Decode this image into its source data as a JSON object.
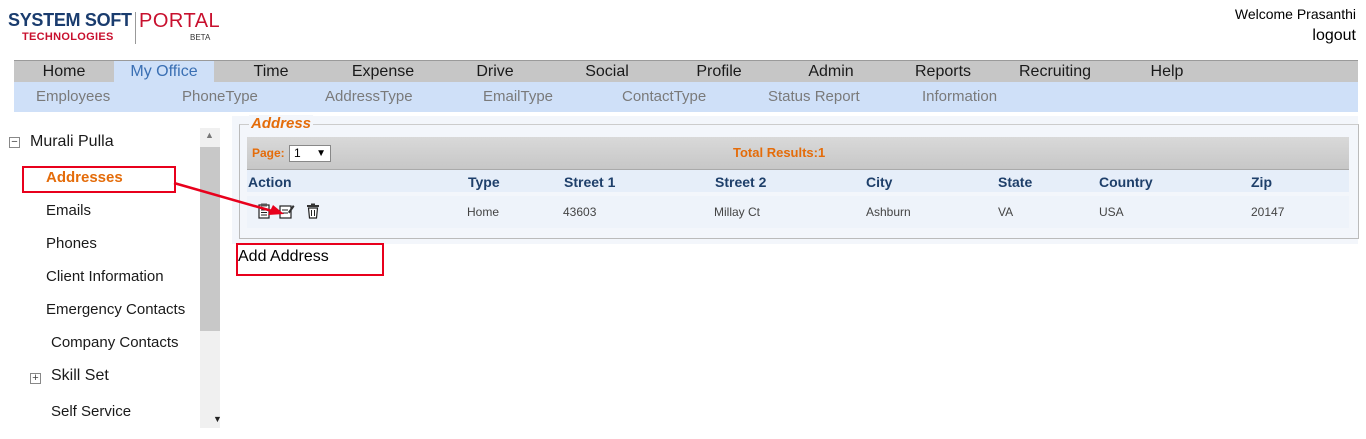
{
  "header": {
    "logo_system_soft": "SYSTEM SOFT",
    "logo_technologies": "TECHNOLOGIES",
    "logo_portal": "PORTAL",
    "logo_beta": "BETA",
    "welcome": "Welcome Prasanthi",
    "logout": "logout"
  },
  "main_nav": [
    {
      "label": "Home"
    },
    {
      "label": "My Office",
      "active": true
    },
    {
      "label": "Time"
    },
    {
      "label": "Expense"
    },
    {
      "label": "Drive"
    },
    {
      "label": "Social"
    },
    {
      "label": "Profile"
    },
    {
      "label": "Admin"
    },
    {
      "label": "Reports"
    },
    {
      "label": "Recruiting"
    },
    {
      "label": "Help"
    }
  ],
  "sub_nav": [
    {
      "label": "Employees"
    },
    {
      "label": "PhoneType"
    },
    {
      "label": "AddressType"
    },
    {
      "label": "EmailType"
    },
    {
      "label": "ContactType"
    },
    {
      "label": "Status Report"
    },
    {
      "label": "Information"
    }
  ],
  "sidebar": {
    "root_label": "Murali Pulla",
    "items": [
      {
        "label": "Addresses",
        "selected": true
      },
      {
        "label": "Emails"
      },
      {
        "label": "Phones"
      },
      {
        "label": "Client Information"
      },
      {
        "label": "Emergency Contacts"
      },
      {
        "label": "Company Contacts"
      },
      {
        "label": "Skill Set"
      },
      {
        "label": "Self Service"
      }
    ]
  },
  "address_panel": {
    "legend": "Address",
    "page_label": "Page:",
    "page_value": "1",
    "total_results": "Total Results:1",
    "columns": [
      "Action",
      "Type",
      "Street 1",
      "Street 2",
      "City",
      "State",
      "Country",
      "Zip"
    ],
    "rows": [
      {
        "type": "Home",
        "street1": "43603",
        "street2": "Millay Ct",
        "city": "Ashburn",
        "state": "VA",
        "country": "USA",
        "zip": "20147"
      }
    ],
    "add_address": "Add Address"
  },
  "colors": {
    "accent_orange": "#e46c0a",
    "header_blue": "#1e3f6a",
    "annotation_red": "#e8001c",
    "nav_active_bg": "#cfe0f8"
  }
}
